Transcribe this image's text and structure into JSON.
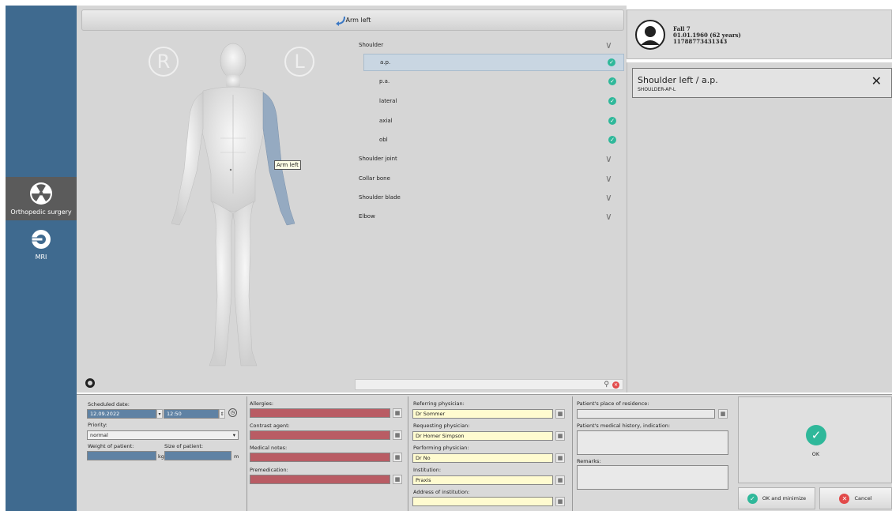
{
  "sidebar": {
    "items": [
      {
        "label": "Orthopedic surgery",
        "icon": "radiation-icon",
        "active": true
      },
      {
        "label": "MRI",
        "icon": "mri-scanner-icon",
        "active": false
      }
    ]
  },
  "header": {
    "title": "Arm left",
    "icon": "return-arrow-icon"
  },
  "figure": {
    "right_marker": "R",
    "left_marker": "L",
    "tooltip": "Arm left"
  },
  "body_parts": [
    {
      "label": "Shoulder",
      "expanded": true
    },
    {
      "label": "a.p.",
      "sub": true,
      "checked": true,
      "selected": true
    },
    {
      "label": "p.a.",
      "sub": true,
      "checked": true
    },
    {
      "label": "lateral",
      "sub": true,
      "checked": true
    },
    {
      "label": "axial",
      "sub": true,
      "checked": true
    },
    {
      "label": "obl",
      "sub": true,
      "checked": true
    },
    {
      "label": "Shoulder joint",
      "expanded": false
    },
    {
      "label": "Collar bone",
      "expanded": false
    },
    {
      "label": "Shoulder blade",
      "expanded": false
    },
    {
      "label": "Elbow",
      "expanded": false
    }
  ],
  "patient": {
    "name": "Fall 7",
    "dob": "01.01.1960 (62 years)",
    "id": "11788773431343"
  },
  "exam": {
    "title": "Shoulder left / a.p.",
    "code": "SHOULDER-AP-L"
  },
  "form": {
    "scheduled_date_label": "Scheduled date:",
    "scheduled_date": "12.09.2022",
    "scheduled_time": "12:50",
    "priority_label": "Priority:",
    "priority": "normal",
    "weight_label": "Weight of patient:",
    "weight_unit": "kg",
    "size_label": "Size of patient:",
    "size_unit": "m",
    "allergies_label": "Allergies:",
    "contrast_label": "Contrast agent:",
    "medical_notes_label": "Medical notes:",
    "premedication_label": "Premedication:",
    "referring_label": "Referring physician:",
    "referring": "Dr Sommer",
    "requesting_label": "Requesting physician:",
    "requesting": "Dr Homer Simpson",
    "performing_label": "Performing physician:",
    "performing": "Dr No",
    "institution_label": "Institution:",
    "institution": "Praxis",
    "address_label": "Address of institution:",
    "residence_label": "Patient's place of residence:",
    "history_label": "Patient's medical history, indication:",
    "remarks_label": "Remarks:"
  },
  "actions": {
    "ok": "OK",
    "ok_minimize": "OK and minimize",
    "cancel": "Cancel"
  },
  "colors": {
    "sidebar": "#3f6a8f",
    "accent_check": "#2fb89a",
    "cancel": "#e24a4a",
    "required_field": "#b95c64",
    "physician_field": "#fffbd0"
  }
}
